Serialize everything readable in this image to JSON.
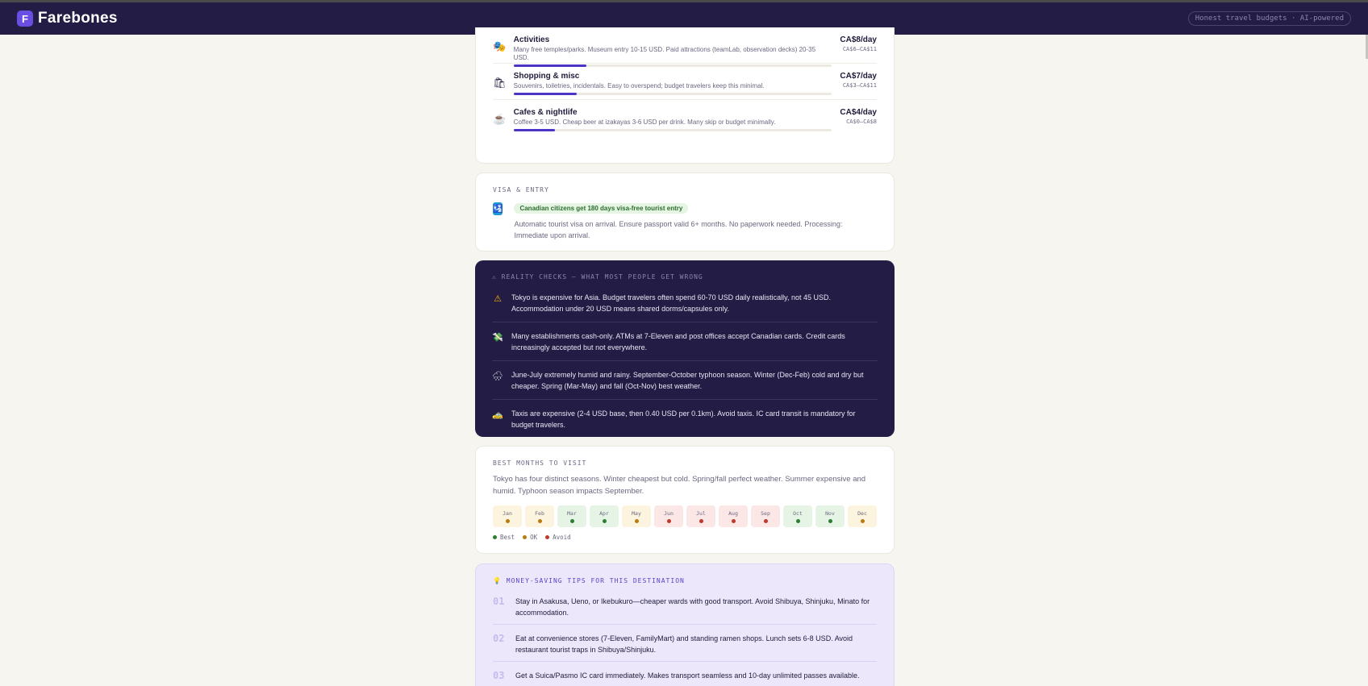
{
  "header": {
    "logo_letter": "F",
    "brand": "Farebones",
    "tagline": "Honest travel budgets · AI-powered"
  },
  "costs": [
    {
      "icon": "theater-masks-icon",
      "glyph": "🎭",
      "title": "Activities",
      "desc": "Many free temples/parks. Museum entry 10-15 USD. Paid attractions (teamLab, observation decks) 20-35 USD.",
      "per_day": "CA$8/day",
      "range": "CA$6–CA$11",
      "bar_fraction": 0.23
    },
    {
      "icon": "shopping-bag-icon",
      "glyph": "🛍",
      "title": "Shopping & misc",
      "desc": "Souvenirs, toiletries, incidentals. Easy to overspend; budget travelers keep this minimal.",
      "per_day": "CA$7/day",
      "range": "CA$3–CA$11",
      "bar_fraction": 0.2
    },
    {
      "icon": "coffee-icon",
      "glyph": "☕",
      "title": "Cafes & nightlife",
      "desc": "Coffee 3-5 USD. Cheap beer at izakayas 3-6 USD per drink. Many skip or budget minimally.",
      "per_day": "CA$4/day",
      "range": "CA$0–CA$8",
      "bar_fraction": 0.13
    }
  ],
  "visa": {
    "label": "VISA & ENTRY",
    "icon": "passport-control-icon",
    "badge": "Canadian citizens get 180 days visa-free tourist entry",
    "text": "Automatic tourist visa on arrival. Ensure passport valid 6+ months. No paperwork needed. Processing: Immediate upon arrival."
  },
  "reality": {
    "label": "⚠ REALITY CHECKS — WHAT MOST PEOPLE GET WRONG",
    "items": [
      {
        "icon": "warning-icon",
        "glyph": "⚠",
        "color": "#f5b301",
        "text": "Tokyo is expensive for Asia. Budget travelers often spend 60-70 USD daily realistically, not 45 USD. Accommodation under 20 USD means shared dorms/capsules only."
      },
      {
        "icon": "money-wings-icon",
        "glyph": "💸",
        "color": "#3ecf6a",
        "text": "Many establishments cash-only. ATMs at 7-Eleven and post offices accept Canadian cards. Credit cards increasingly accepted but not everywhere."
      },
      {
        "icon": "cloud-rain-icon",
        "glyph": "🌧",
        "color": "#dfe3ea",
        "text": "June-July extremely humid and rainy. September-October typhoon season. Winter (Dec-Feb) cold and dry but cheaper. Spring (Mar-May) and fall (Oct-Nov) best weather."
      },
      {
        "icon": "taxi-icon",
        "glyph": "🚕",
        "color": "#f5c518",
        "text": "Taxis are expensive (2-4 USD base, then 0.40 USD per 0.1km). Avoid taxis. IC card transit is mandatory for budget travelers."
      }
    ]
  },
  "months": {
    "label": "BEST MONTHS TO VISIT",
    "desc": "Tokyo has four distinct seasons. Winter cheapest but cold. Spring/fall perfect weather. Summer expensive and humid. Typhoon season impacts September.",
    "items": [
      {
        "name": "Jan",
        "rating": "ok"
      },
      {
        "name": "Feb",
        "rating": "ok"
      },
      {
        "name": "Mar",
        "rating": "best"
      },
      {
        "name": "Apr",
        "rating": "best"
      },
      {
        "name": "May",
        "rating": "ok"
      },
      {
        "name": "Jun",
        "rating": "avoid"
      },
      {
        "name": "Jul",
        "rating": "avoid"
      },
      {
        "name": "Aug",
        "rating": "avoid"
      },
      {
        "name": "Sep",
        "rating": "avoid"
      },
      {
        "name": "Oct",
        "rating": "best"
      },
      {
        "name": "Nov",
        "rating": "best"
      },
      {
        "name": "Dec",
        "rating": "ok"
      }
    ],
    "legend": {
      "best": "Best",
      "ok": "OK",
      "avoid": "Avoid"
    },
    "colors": {
      "best": "#2e7d32",
      "ok": "#b97a0e",
      "avoid": "#c0392b"
    }
  },
  "tips": {
    "icon": "lightbulb-icon",
    "glyph": "💡",
    "label": "MONEY-SAVING TIPS FOR THIS DESTINATION",
    "items": [
      {
        "num": "01",
        "text": "Stay in Asakusa, Ueno, or Ikebukuro—cheaper wards with good transport. Avoid Shibuya, Shinjuku, Minato for accommodation."
      },
      {
        "num": "02",
        "text": "Eat at convenience stores (7-Eleven, FamilyMart) and standing ramen shops. Lunch sets 6-8 USD. Avoid restaurant tourist traps in Shibuya/Shinjuku."
      },
      {
        "num": "03",
        "text": "Get a Suica/Pasmo IC card immediately. Makes transport seamless and 10-day unlimited passes available."
      }
    ]
  }
}
